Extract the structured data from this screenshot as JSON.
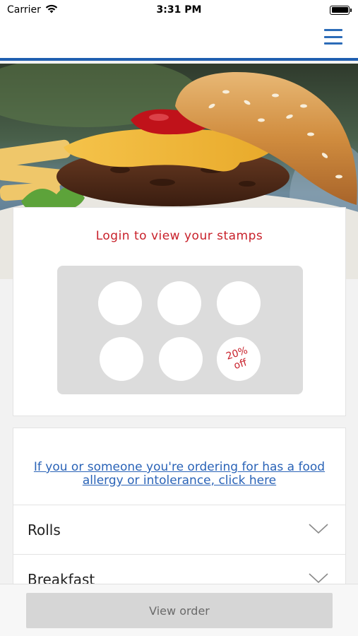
{
  "status_bar": {
    "carrier": "Carrier",
    "time": "3:31 PM",
    "icons": [
      "wifi-icon",
      "battery-icon"
    ]
  },
  "nav": {
    "menu_icon": "hamburger-menu-icon",
    "accent_color": "#1f5fb0"
  },
  "hero": {
    "image": "burger-photo"
  },
  "stamps": {
    "title": "Login to view your stamps",
    "total": 6,
    "collected": 0,
    "reward_label": "20%\noff",
    "accent_color": "#c8202a"
  },
  "allergy": {
    "link_text": "If you or someone you're ordering for has a food allergy or intolerance, click here"
  },
  "categories": [
    {
      "label": "Rolls",
      "icon": "chevron-down-icon"
    },
    {
      "label": "Breakfast",
      "icon": "chevron-down-icon"
    }
  ],
  "order": {
    "button_label": "View order"
  }
}
